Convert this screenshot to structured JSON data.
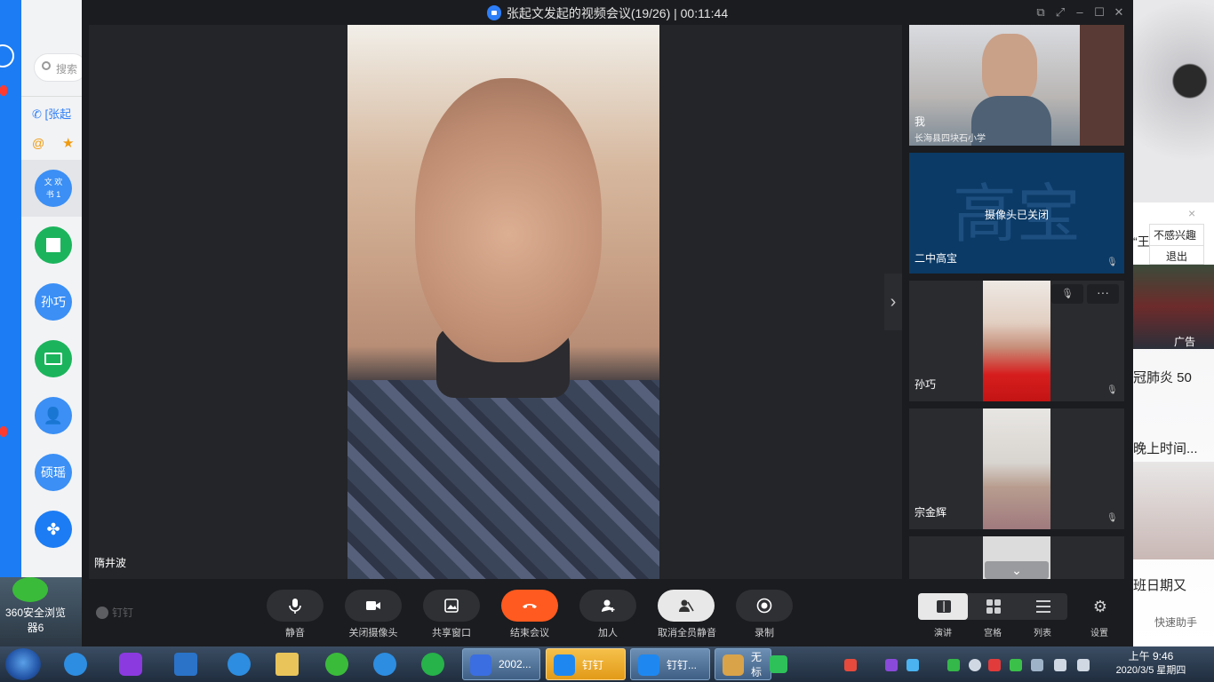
{
  "window": {
    "title": "张起文发起的视频会议(19/26) | 00:11:44",
    "controls": [
      "external-link-icon",
      "fullscreen-icon",
      "minimize-icon",
      "maximize-icon",
      "close-icon"
    ]
  },
  "main_video": {
    "speaker_name": "隋井波"
  },
  "participants": [
    {
      "name": "我",
      "subtitle": "长海县四块石小学",
      "camera": "on"
    },
    {
      "name": "二中高宝",
      "avatar_text": "高宝",
      "status": "摄像头已关闭",
      "camera": "off",
      "avatar_color": "#0b3a66"
    },
    {
      "name": "孙巧",
      "camera": "on"
    },
    {
      "name": "宗金辉",
      "camera": "on"
    },
    {
      "name": "",
      "camera": "on"
    }
  ],
  "toolbar": {
    "brand": "钉钉",
    "buttons": [
      {
        "label": "静音",
        "icon": "microphone-icon"
      },
      {
        "label": "关闭摄像头",
        "icon": "camera-icon"
      },
      {
        "label": "共享窗口",
        "icon": "share-screen-icon"
      },
      {
        "label": "结束会议",
        "icon": "hangup-icon"
      },
      {
        "label": "加人",
        "icon": "add-person-icon"
      },
      {
        "label": "取消全员静音",
        "icon": "unmute-all-icon"
      },
      {
        "label": "录制",
        "icon": "record-icon"
      }
    ],
    "views": [
      {
        "label": "演讲",
        "icon": "speaker-view-icon",
        "active": true
      },
      {
        "label": "宫格",
        "icon": "grid-view-icon",
        "active": false
      },
      {
        "label": "列表",
        "icon": "list-view-icon",
        "active": false
      }
    ],
    "settings_label": "设置"
  },
  "background_left": {
    "search_placeholder": "搜索",
    "chat_preview": "[张起",
    "avatars": [
      {
        "text": "文 欢 书 1",
        "color": "#3b8ff5"
      },
      {
        "text": "",
        "color": "#1bb45c",
        "icon": "building-icon"
      },
      {
        "text": "孙巧",
        "color": "#3b8ff5"
      },
      {
        "text": "",
        "color": "#1bb45c",
        "icon": "folder-icon"
      },
      {
        "text": "",
        "color": "#3b8ff5",
        "icon": "add-user-icon"
      },
      {
        "text": "硕瑶",
        "color": "#3b8ff5"
      },
      {
        "text": "",
        "color": "#1c7cf3",
        "icon": "apps-icon"
      }
    ],
    "desktop_icon_label": "360安全浏览器6"
  },
  "background_right": {
    "ad_close": "×",
    "menu_items": [
      "不感兴趣",
      "退出"
    ],
    "ad_label": "广告",
    "headline_quote": "“王",
    "news": [
      "冠肺炎 50",
      "晚上时间...",
      "班日期又"
    ],
    "footer": "快速助手"
  },
  "taskbar": {
    "windows": [
      {
        "label": "2002...",
        "active": false
      },
      {
        "label": "钉钉",
        "active": true
      },
      {
        "label": "钉钉...",
        "active": false
      },
      {
        "label": "无标",
        "active": false
      }
    ],
    "time": "上午 9:46",
    "date": "2020/3/5 星期四"
  }
}
